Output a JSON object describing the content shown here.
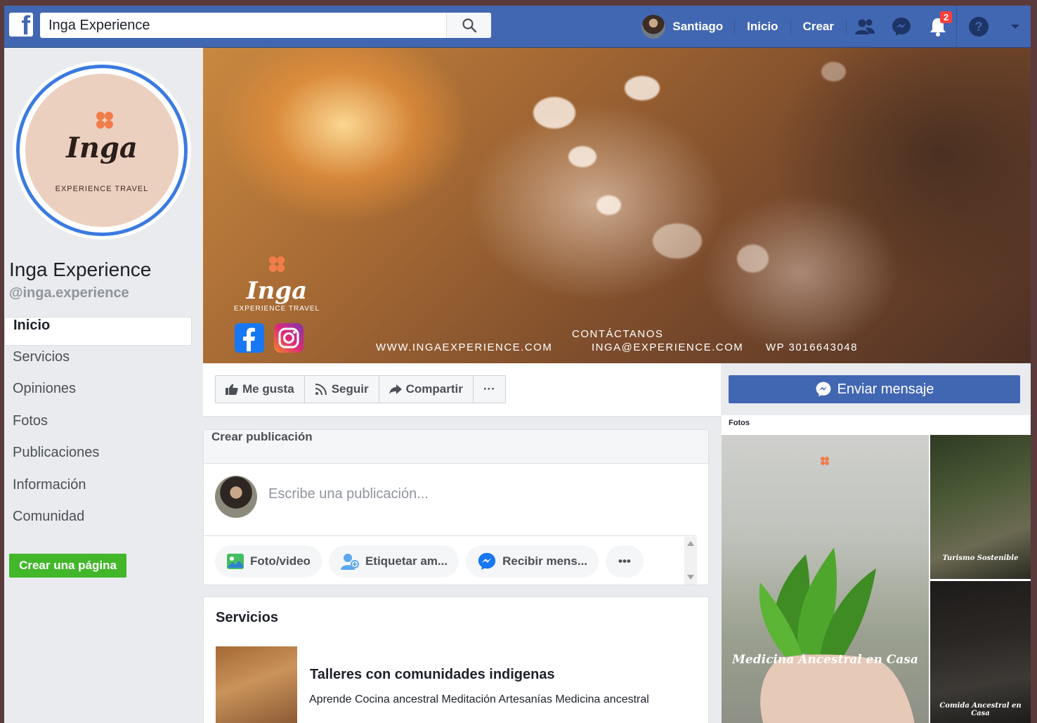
{
  "topbar": {
    "search_value": "Inga Experience",
    "user_name": "Santiago",
    "nav_home": "Inicio",
    "nav_create": "Crear",
    "notification_count": "2"
  },
  "profile": {
    "logo_word": "Inga",
    "logo_sub": "EXPERIENCE TRAVEL",
    "name": "Inga Experience",
    "handle": "@inga.experience"
  },
  "sidebar": {
    "items": [
      {
        "label": "Inicio"
      },
      {
        "label": "Servicios"
      },
      {
        "label": "Opiniones"
      },
      {
        "label": "Fotos"
      },
      {
        "label": "Publicaciones"
      },
      {
        "label": "Información"
      },
      {
        "label": "Comunidad"
      }
    ],
    "create_page": "Crear una página"
  },
  "cover": {
    "logo_word": "Inga",
    "logo_sub": "EXPERIENCE TRAVEL",
    "website": "WWW.INGAEXPERIENCE.COM",
    "contact_title": "CONTÁCTANOS",
    "email": "INGA@EXPERIENCE.COM",
    "phone": "WP 3016643048"
  },
  "actions": {
    "like": "Me gusta",
    "follow": "Seguir",
    "share": "Compartir",
    "more": "···",
    "send_message": "Enviar mensaje"
  },
  "post": {
    "header": "Crear publicación",
    "placeholder": "Escribe una publicación...",
    "chips": [
      {
        "label": "Foto/video"
      },
      {
        "label": "Etiquetar am..."
      },
      {
        "label": "Recibir mens..."
      },
      {
        "label": "•••"
      }
    ]
  },
  "photos": {
    "label": "Fotos",
    "caption_big": "Medicina Ancestral en Casa",
    "caption_small1": "Turismo Sostenible",
    "caption_small2": "Comida Ancestral en Casa"
  },
  "services": {
    "title": "Servicios",
    "item_title": "Talleres con comunidades indigenas",
    "item_desc": "Aprende Cocina ancestral Meditación Artesanías Medicina ancestral"
  },
  "colors": {
    "fb_blue": "#4267b2",
    "green": "#42b72a",
    "badge_red": "#fa3e3e",
    "ring_blue": "#3b7ae0"
  }
}
